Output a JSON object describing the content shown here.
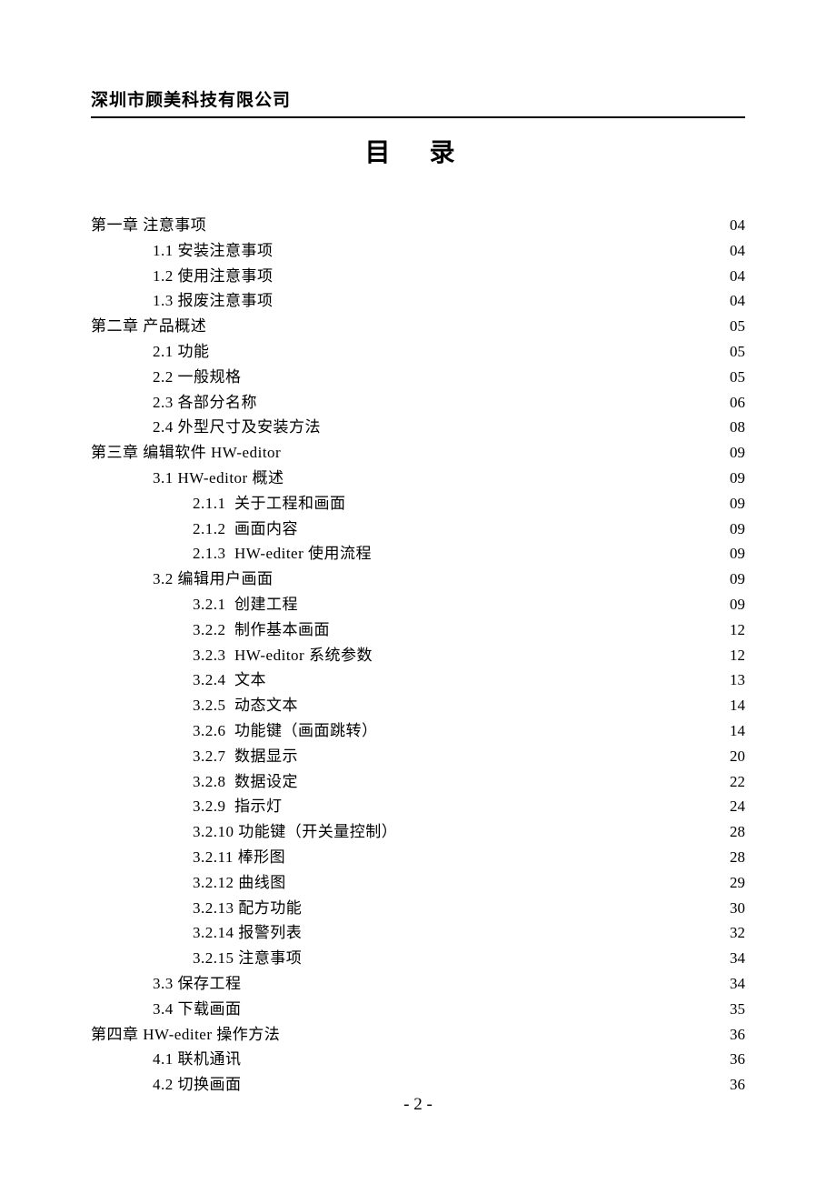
{
  "company": "深圳市顾美科技有限公司",
  "title": "目  录",
  "page_number": "- 2 -",
  "toc": [
    {
      "indent": 0,
      "label": "第一章 注意事项",
      "page": "04"
    },
    {
      "indent": 1,
      "label": "1.1 安装注意事项",
      "page": "04"
    },
    {
      "indent": 1,
      "label": "1.2 使用注意事项",
      "page": "04"
    },
    {
      "indent": 1,
      "label": "1.3 报废注意事项",
      "page": "04"
    },
    {
      "indent": 0,
      "label": "第二章 产品概述",
      "page": "05"
    },
    {
      "indent": 1,
      "label": "2.1 功能",
      "page": "05"
    },
    {
      "indent": 1,
      "label": "2.2 一般规格",
      "page": "05"
    },
    {
      "indent": 1,
      "label": "2.3 各部分名称",
      "page": "06"
    },
    {
      "indent": 1,
      "label": "2.4 外型尺寸及安装方法",
      "page": "08"
    },
    {
      "indent": 0,
      "label": "第三章 编辑软件 HW-editor",
      "page": "09"
    },
    {
      "indent": 1,
      "label": "3.1 HW-editor 概述",
      "page": "09"
    },
    {
      "indent": 2,
      "label": "2.1.1  关于工程和画面",
      "page": "09"
    },
    {
      "indent": 2,
      "label": "2.1.2  画面内容",
      "page": "09"
    },
    {
      "indent": 2,
      "label": "2.1.3  HW-editer 使用流程",
      "page": "09"
    },
    {
      "indent": 1,
      "label": "3.2 编辑用户画面",
      "page": "09"
    },
    {
      "indent": 2,
      "label": "3.2.1  创建工程",
      "page": "09"
    },
    {
      "indent": 2,
      "label": "3.2.2  制作基本画面",
      "page": "12"
    },
    {
      "indent": 2,
      "label": "3.2.3  HW-editor 系统参数",
      "page": "12"
    },
    {
      "indent": 2,
      "label": "3.2.4  文本",
      "page": "13"
    },
    {
      "indent": 2,
      "label": "3.2.5  动态文本",
      "page": "14"
    },
    {
      "indent": 2,
      "label": "3.2.6  功能键（画面跳转）",
      "page": "14"
    },
    {
      "indent": 2,
      "label": "3.2.7  数据显示",
      "page": "20"
    },
    {
      "indent": 2,
      "label": "3.2.8  数据设定",
      "page": "22"
    },
    {
      "indent": 2,
      "label": "3.2.9  指示灯",
      "page": "24"
    },
    {
      "indent": 2,
      "label": "3.2.10 功能键（开关量控制）",
      "page": "28"
    },
    {
      "indent": 2,
      "label": "3.2.11 棒形图",
      "page": "28"
    },
    {
      "indent": 2,
      "label": "3.2.12 曲线图",
      "page": "29"
    },
    {
      "indent": 2,
      "label": "3.2.13 配方功能",
      "page": "30"
    },
    {
      "indent": 2,
      "label": "3.2.14 报警列表",
      "page": "32"
    },
    {
      "indent": 2,
      "label": "3.2.15 注意事项",
      "page": "34"
    },
    {
      "indent": 1,
      "label": "3.3 保存工程",
      "page": "34"
    },
    {
      "indent": 1,
      "label": "3.4 下载画面",
      "page": "35"
    },
    {
      "indent": 0,
      "label": "第四章 HW-editer 操作方法",
      "page": "36"
    },
    {
      "indent": 1,
      "label": "4.1 联机通讯",
      "page": "36"
    },
    {
      "indent": 1,
      "label": "4.2 切换画面",
      "page": "36"
    }
  ]
}
